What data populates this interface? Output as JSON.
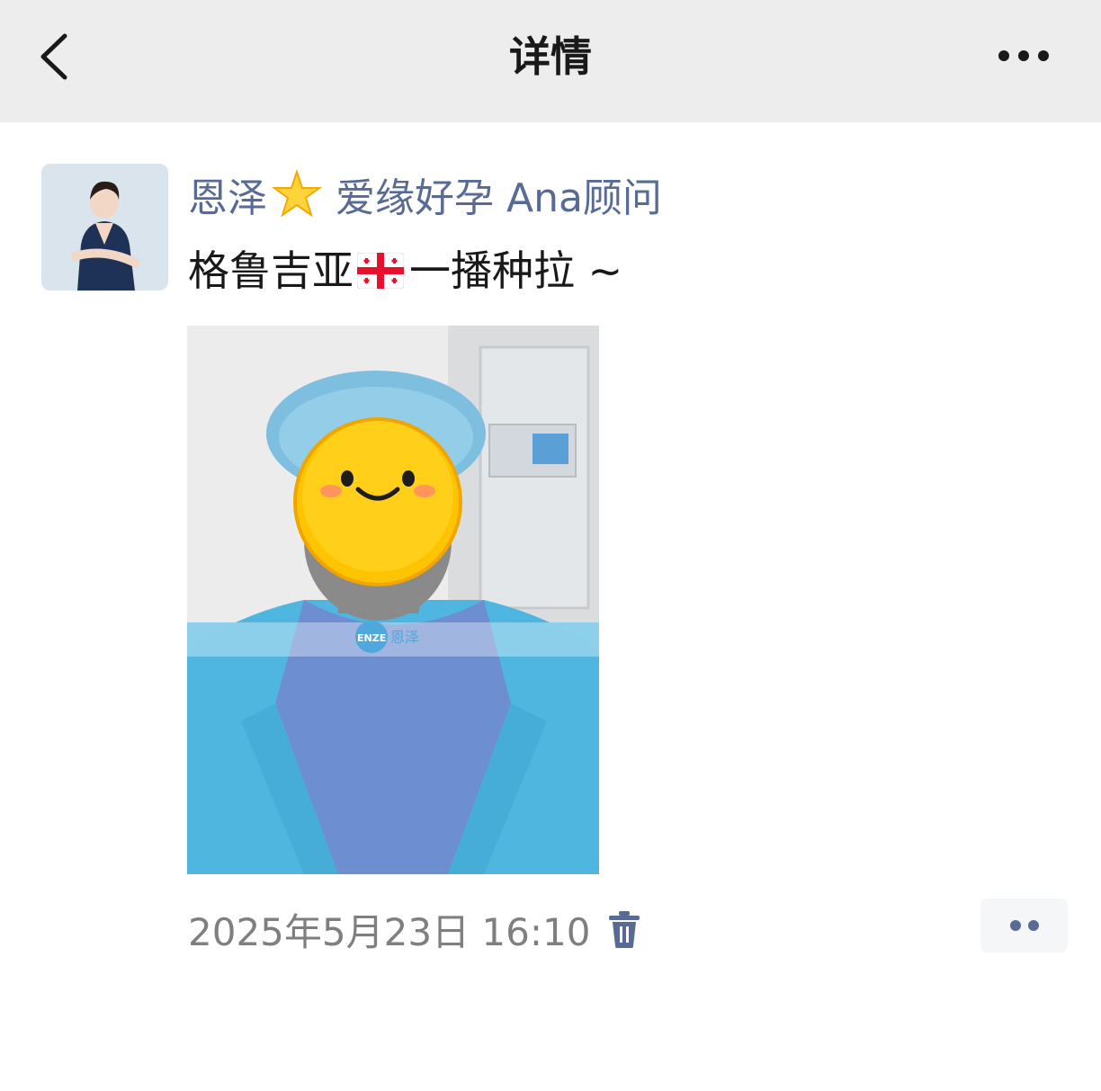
{
  "header": {
    "title": "详情",
    "back_icon": "chevron-left-icon",
    "more_icon": "more-dots-icon"
  },
  "post": {
    "author_name_prefix": "恩泽",
    "author_name_suffix": "爱缘好孕 Ana顾问",
    "author_emoji": "star-emoji",
    "text_prefix": "格鲁吉亚",
    "text_suffix": "一播种拉 ~",
    "text_emoji": "georgia-flag-emoji",
    "photo_watermark": "ENZE 恩泽",
    "timestamp": "2025年5月23日 16:10",
    "delete_icon": "trash-icon",
    "action_icon": "comment-dots-icon"
  },
  "colors": {
    "topbar_bg": "#ededed",
    "name_link": "#576b95",
    "body_text": "#191919",
    "time_text": "#7f7f7f",
    "icon_blue": "#576b95"
  }
}
